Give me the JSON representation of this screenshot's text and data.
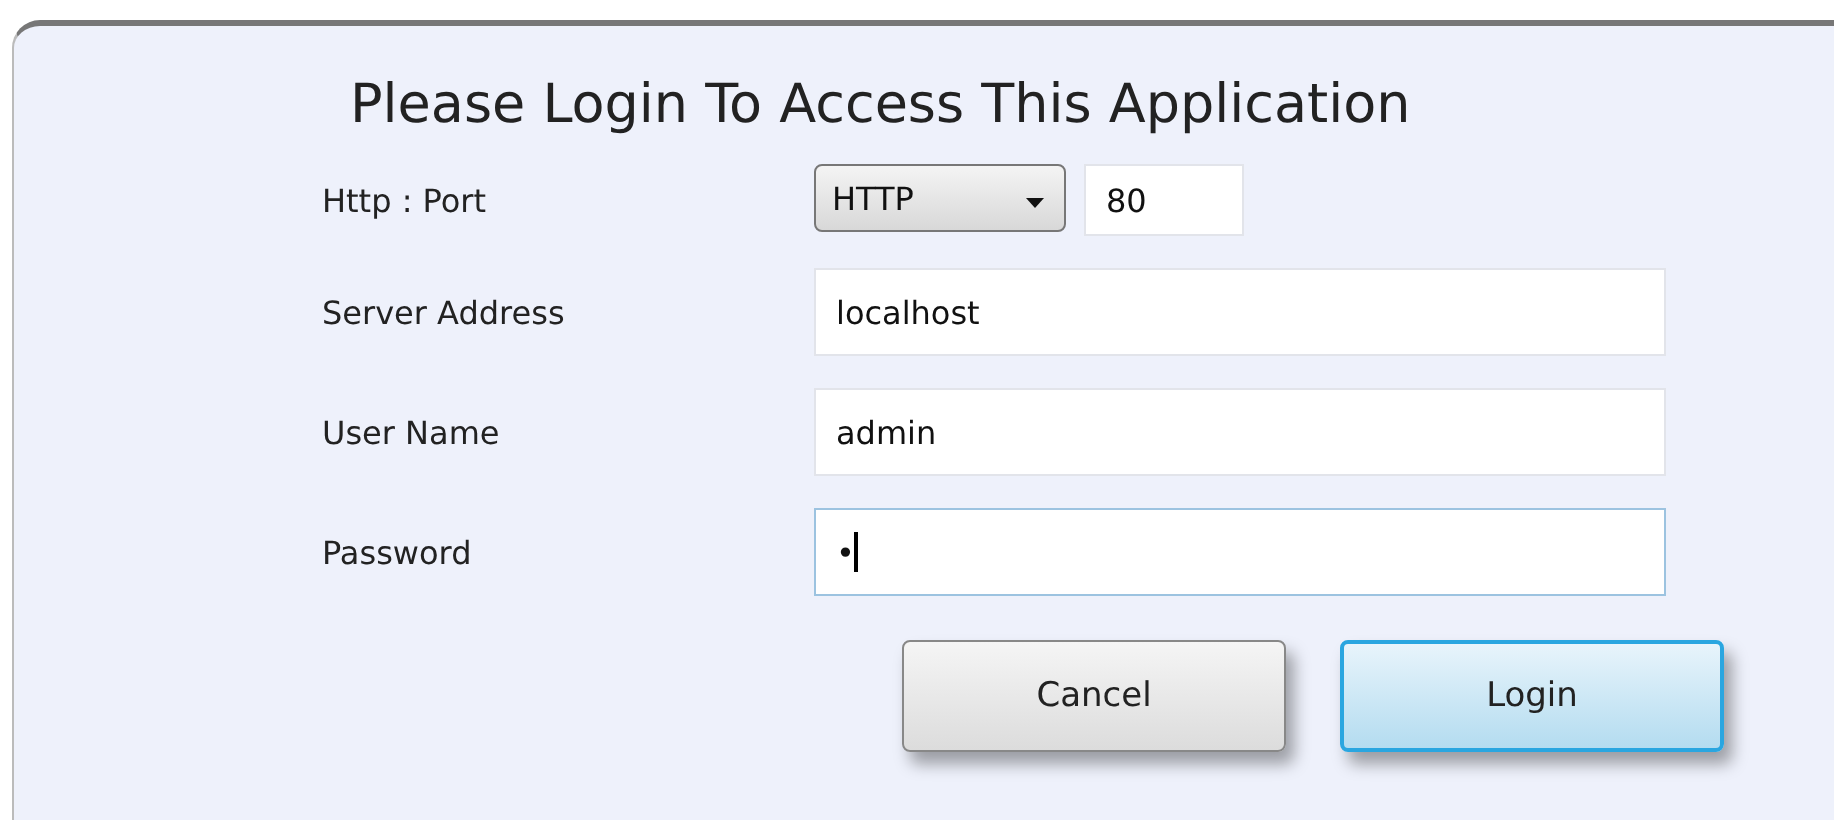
{
  "title": "Please Login To Access This Application",
  "fields": [
    {
      "kind": "protocol",
      "label": "Http : Port",
      "protocol": "HTTP",
      "value": "80"
    },
    {
      "kind": "text",
      "label": "Server Address",
      "value": "localhost",
      "focused": false
    },
    {
      "kind": "text",
      "label": "User Name",
      "value": "admin",
      "focused": false
    },
    {
      "kind": "password",
      "label": "Password",
      "value": "•",
      "focused": true
    }
  ],
  "buttons": [
    {
      "label": "Cancel",
      "default": false
    },
    {
      "label": "Login",
      "default": true
    }
  ]
}
